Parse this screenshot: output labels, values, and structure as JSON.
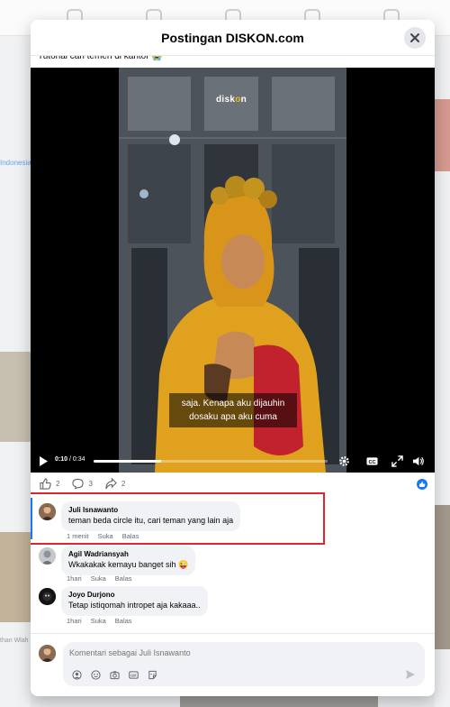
{
  "modal": {
    "title": "Postingan DISKON.com",
    "post_text": "Tutorial cari temen di kantor 😭"
  },
  "background": {
    "left_text": "Indonesia",
    "left_text2": "than Wlah"
  },
  "video": {
    "logo_pre": "disk",
    "logo_o": "o",
    "logo_post": "n",
    "caption": "saja. Kenapa aku dijauhin dosaku apa aku cuma",
    "current_time": "0:10",
    "duration": "/ 0:34",
    "progress": 0.29
  },
  "reactions": {
    "likes": "2",
    "comments": "3",
    "shares": "2"
  },
  "comments": [
    {
      "name": "Juli Isnawanto",
      "text": "teman beda circle itu, cari teman yang lain aja",
      "time": "1 menit",
      "like": "Suka",
      "reply": "Balas"
    },
    {
      "name": "Agil Wadriansyah",
      "text": "Wkakakak kemayu banget sih 😜",
      "time": "1hari",
      "like": "Suka",
      "reply": "Balas"
    },
    {
      "name": "Joyo Durjono",
      "text": "Tetap istiqomah intropet aja kakaaa..",
      "time": "1hari",
      "like": "Suka",
      "reply": "Balas"
    }
  ],
  "composer": {
    "placeholder": "Komentari sebagai Juli Isnawanto"
  },
  "colors": {
    "accent": "#1877f2",
    "highlight": "#e0262c"
  }
}
